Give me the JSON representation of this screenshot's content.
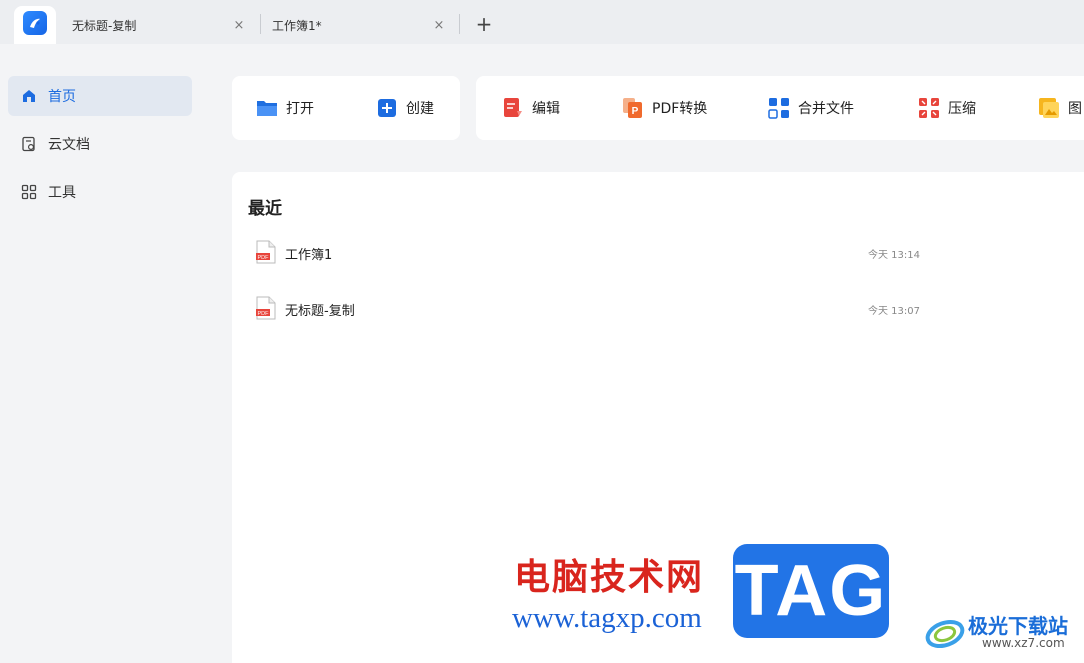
{
  "tabs": [
    {
      "label": "无标题-复制",
      "close": "×"
    },
    {
      "label": "工作簿1*",
      "close": "×"
    }
  ],
  "tab_add": "+",
  "sidebar": {
    "items": [
      {
        "label": "首页",
        "icon": "home-icon"
      },
      {
        "label": "云文档",
        "icon": "cloud-doc-icon"
      },
      {
        "label": "工具",
        "icon": "grid-tools-icon"
      }
    ]
  },
  "quick_actions": {
    "open": "打开",
    "create": "创建"
  },
  "tools": {
    "edit": "编辑",
    "pdf_convert": "PDF转换",
    "merge": "合并文件",
    "compress": "压缩",
    "image": "图"
  },
  "recent": {
    "title": "最近",
    "files": [
      {
        "name": "工作簿1",
        "time": "今天 13:14",
        "icon": "pdf-file-icon"
      },
      {
        "name": "无标题-复制",
        "time": "今天 13:07",
        "icon": "pdf-file-icon"
      }
    ]
  },
  "watermark": {
    "cn_text": "电脑技术网",
    "url": "www.tagxp.com",
    "tag": "TAG",
    "site_name": "极光下载站",
    "site_url": "www.xz7.com"
  },
  "colors": {
    "accent": "#1d6ce0",
    "active_bg": "#e2e8f1",
    "watermark_red": "#d9251d",
    "watermark_blue": "#2274e6"
  }
}
